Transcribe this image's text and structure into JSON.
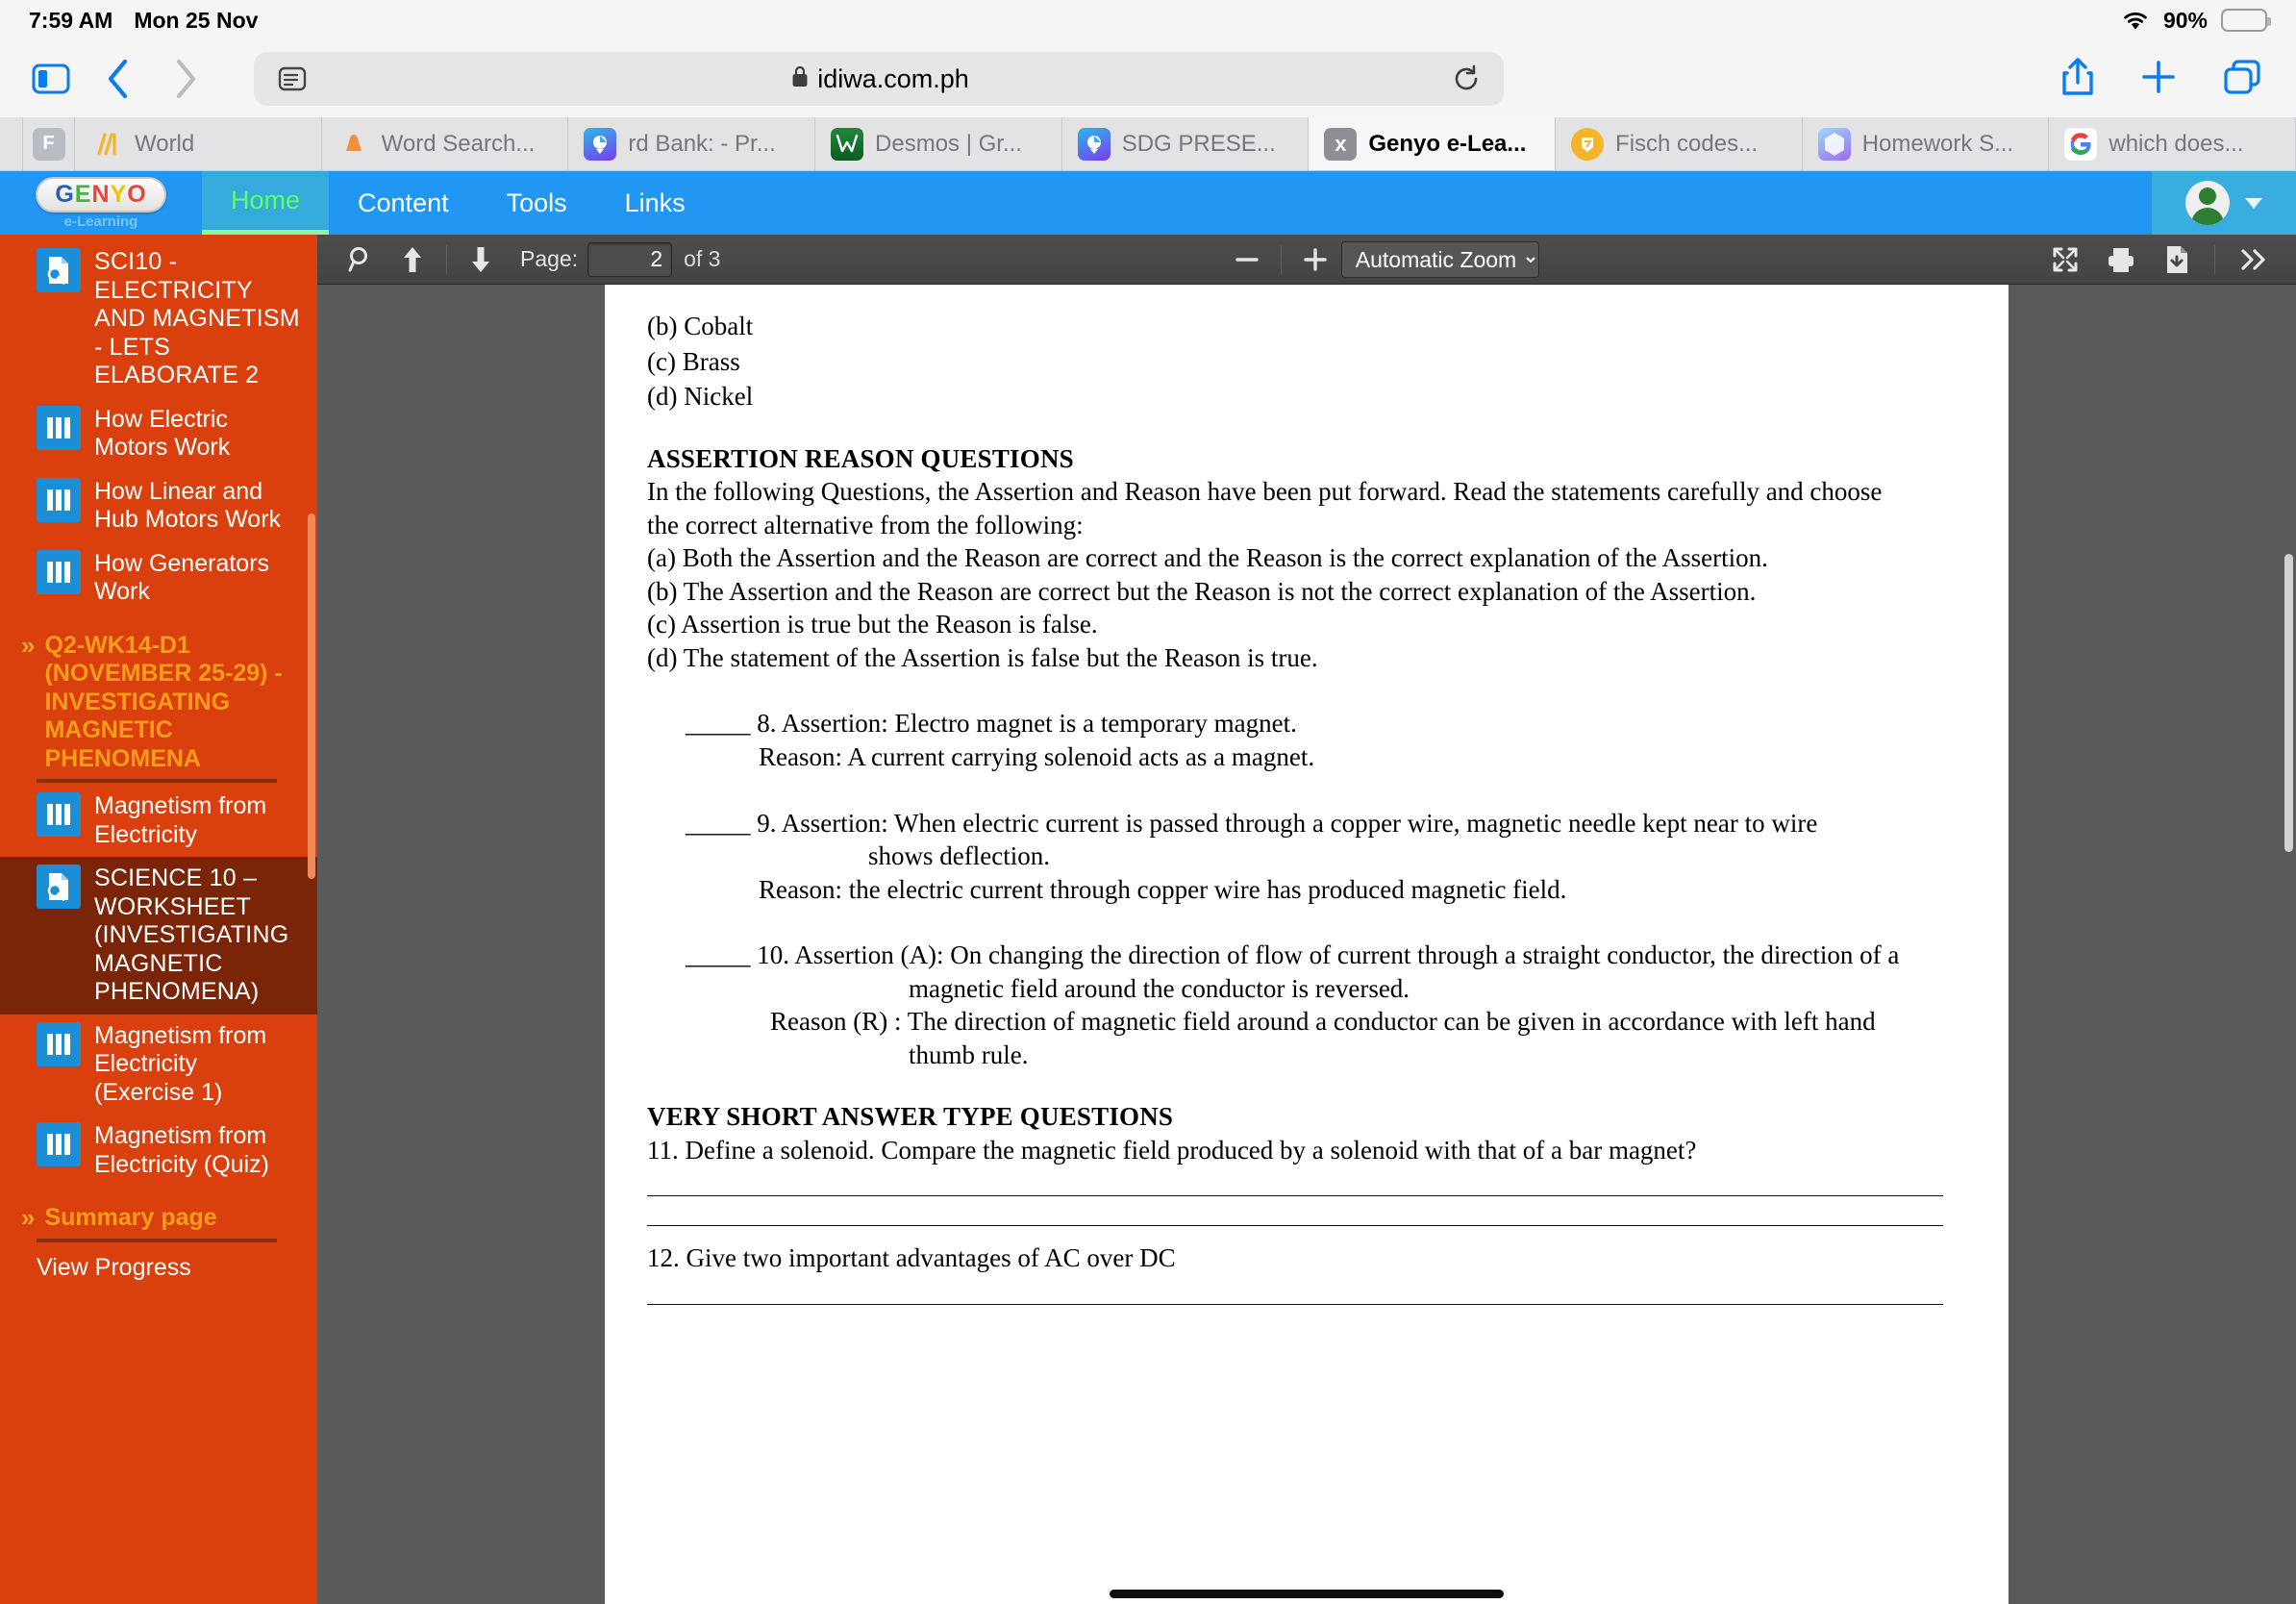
{
  "status_bar": {
    "time": "7:59 AM",
    "date": "Mon 25 Nov",
    "battery_percent": "90%",
    "wifi_icon": "wifi-icon",
    "battery_icon": "battery-icon",
    "battery_color": "#f7c600"
  },
  "browser": {
    "sidebar_toggle_icon": "sidebar-toggle-icon",
    "back_icon": "chevron-left-icon",
    "forward_icon": "chevron-right-icon",
    "reader_icon": "reader-view-icon",
    "lock_icon": "lock-icon",
    "url": "idiwa.com.ph",
    "reload_icon": "reload-icon",
    "share_icon": "share-icon",
    "new_tab_icon": "plus-icon",
    "tab_overview_icon": "tabs-icon",
    "tabs": [
      {
        "label": "",
        "favicon_text": "F",
        "favicon_color": "#b9bcc2",
        "active": false,
        "narrow": true
      },
      {
        "label": "World ",
        "favicon_text": "",
        "favicon_color": "#ffffff",
        "active": false,
        "narrow": false
      },
      {
        "label": "Word Search...",
        "favicon_text": "",
        "favicon_color": "#ffffff",
        "active": false,
        "narrow": false
      },
      {
        "label": "rd Bank: - Pr...",
        "favicon_text": "",
        "favicon_color": "#ffffff",
        "active": false,
        "narrow": false
      },
      {
        "label": "Desmos | Gr...",
        "favicon_text": "",
        "favicon_color": "#ffffff",
        "active": false,
        "narrow": false
      },
      {
        "label": "SDG PRESE...",
        "favicon_text": "",
        "favicon_color": "#ffffff",
        "active": false,
        "narrow": false
      },
      {
        "label": "Genyo e-Lea...",
        "favicon_text": "x",
        "favicon_color": "#8e8e93",
        "active": true,
        "narrow": false
      },
      {
        "label": "Fisch codes...",
        "favicon_text": "",
        "favicon_color": "#ffffff",
        "active": false,
        "narrow": false
      },
      {
        "label": "Homework S...",
        "favicon_text": "",
        "favicon_color": "#ffffff",
        "active": false,
        "narrow": false
      },
      {
        "label": "which does...",
        "favicon_text": "",
        "favicon_color": "#ffffff",
        "active": false,
        "narrow": false
      }
    ]
  },
  "genyo": {
    "brand_letters": [
      "G",
      "E",
      "N",
      "Y",
      "O"
    ],
    "brand_sub": "e-Learning",
    "nav": [
      {
        "label": "Home",
        "active": true
      },
      {
        "label": "Content",
        "active": false
      },
      {
        "label": "Tools",
        "active": false
      },
      {
        "label": "Links",
        "active": false
      }
    ],
    "accent_blue": "#2196f3",
    "accent_green": "#5dff6a",
    "avatar_icon": "avatar",
    "user_caret_icon": "chevron-down-icon"
  },
  "sidebar": {
    "background": "#d9400d",
    "items": [
      {
        "type": "item",
        "icon": "worksheet-icon",
        "label": "SCI10 - ELECTRICITY AND MAGNETISM - LETS ELABORATE 2",
        "selected": false
      },
      {
        "type": "item",
        "icon": "video-icon",
        "label": "How Electric Motors Work",
        "selected": false
      },
      {
        "type": "item",
        "icon": "video-icon",
        "label": "How Linear and Hub Motors Work",
        "selected": false
      },
      {
        "type": "item",
        "icon": "video-icon",
        "label": "How Generators Work",
        "selected": false
      },
      {
        "type": "section",
        "chevron": "double-chevron-right-icon",
        "label": "Q2-WK14-D1 (NOVEMBER 25-29) - INVESTIGATING MAGNETIC PHENOMENA"
      },
      {
        "type": "item",
        "icon": "video-icon",
        "label": "Magnetism from Electricity",
        "selected": false
      },
      {
        "type": "item",
        "icon": "worksheet-icon",
        "label": "SCIENCE 10 – WORKSHEET (INVESTIGATING MAGNETIC PHENOMENA)",
        "selected": true
      },
      {
        "type": "item",
        "icon": "video-icon",
        "label": "Magnetism from Electricity (Exercise 1)",
        "selected": false
      },
      {
        "type": "item",
        "icon": "video-icon",
        "label": "Magnetism from Electricity (Quiz)",
        "selected": false
      },
      {
        "type": "section",
        "chevron": "double-chevron-right-icon",
        "label": "Summary page"
      },
      {
        "type": "link",
        "label": "View Progress"
      }
    ]
  },
  "pdf_toolbar": {
    "search_icon": "search-icon",
    "prev_page_icon": "arrow-up-icon",
    "next_page_icon": "arrow-down-icon",
    "page_label": "Page:",
    "page_value": "2",
    "page_total": "of 3",
    "zoom_out_icon": "minus-icon",
    "zoom_in_icon": "plus-icon",
    "zoom_value": "Automatic Zoom",
    "presentation_icon": "fullscreen-icon",
    "print_icon": "print-icon",
    "download_icon": "download-icon",
    "more_icon": "double-chevron-right-icon"
  },
  "document": {
    "options": [
      "(b) Cobalt",
      "(c) Brass",
      "(d) Nickel"
    ],
    "assertion_heading": "ASSERTION REASON QUESTIONS",
    "assertion_intro_line1": "In the following Questions, the Assertion and Reason have been put forward. Read the statements carefully and choose",
    "assertion_intro_line2": "the correct alternative from the following:",
    "assertion_choices": [
      "(a) Both the Assertion and the Reason are correct and the Reason is the correct explanation of the Assertion.",
      "(b) The Assertion and the Reason are correct but the Reason is not the correct explanation of the Assertion.",
      "(c) Assertion is true but the Reason is false.",
      "(d) The statement of the Assertion is false but the Reason is true."
    ],
    "q8_blank": "_____",
    "q8_line1": "8. Assertion: Electro magnet is a temporary magnet.",
    "q8_line2": "Reason: A current carrying solenoid acts as a magnet.",
    "q9_blank": "_____",
    "q9_line1": "9. Assertion: When electric current is passed through a copper wire, magnetic needle kept near to wire",
    "q9_line2": "shows deflection.",
    "q9_line3": "Reason: the electric current through copper wire has produced magnetic field.",
    "q10_blank": "_____",
    "q10_line1": "10. Assertion (A): On changing the direction of flow of current through a straight conductor, the direction of a",
    "q10_line2": "magnetic field around the conductor is reversed.",
    "q10_line3": "Reason (R) : The direction of magnetic field around a conductor can be given in accordance with left hand",
    "q10_line4": "thumb rule.",
    "very_short_heading": "VERY SHORT ANSWER TYPE QUESTIONS",
    "q11": "11. Define a solenoid. Compare the magnetic field produced by a solenoid with that of a bar magnet?",
    "q12": "12. Give two important advantages of AC over DC"
  }
}
